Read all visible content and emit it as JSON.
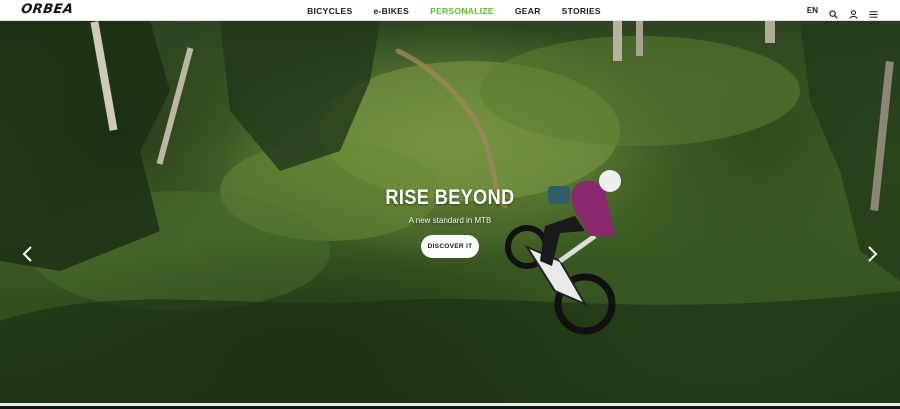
{
  "header": {
    "logo_text": "ORBEA",
    "nav": [
      {
        "label": "BICYCLES",
        "active": false
      },
      {
        "label": "e-BIKES",
        "active": false
      },
      {
        "label": "PERSONALIZE",
        "active": true
      },
      {
        "label": "GEAR",
        "active": false
      },
      {
        "label": "STORIES",
        "active": false
      }
    ],
    "language": "EN",
    "icons": [
      "search-icon",
      "user-icon",
      "menu-icon"
    ]
  },
  "hero": {
    "title": "RISE BEYOND",
    "subtitle": "A new standard in MTB",
    "cta_label": "DISCOVER IT",
    "arrows": [
      "chevron-left-icon",
      "chevron-right-icon"
    ]
  },
  "colors": {
    "accent": "#5cc32a",
    "header_bg": "#ffffff",
    "text_dark": "#1a1a1a",
    "rider_jersey": "#8a2a6e"
  }
}
